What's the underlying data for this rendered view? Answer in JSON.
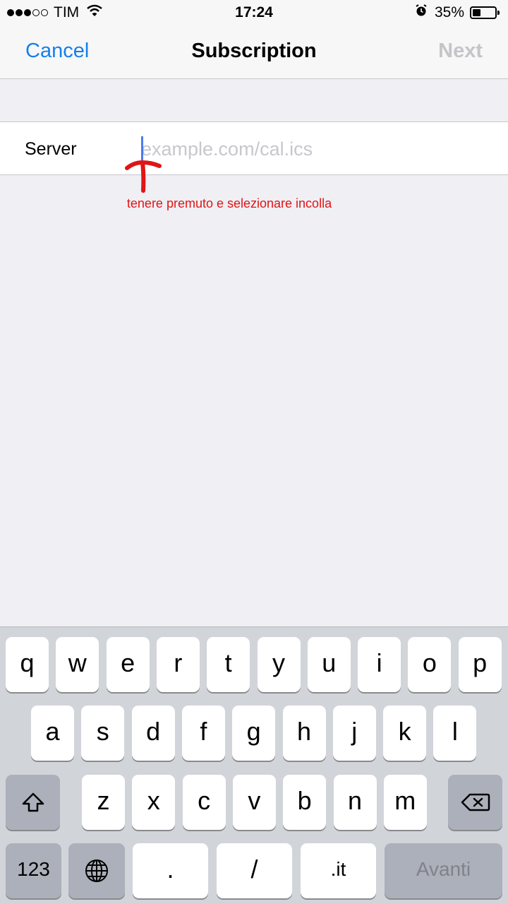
{
  "status_bar": {
    "signal_dots_filled": 3,
    "signal_dots_empty": 2,
    "carrier": "TIM",
    "time": "17:24",
    "battery_percent": "35%",
    "battery_level": 0.35,
    "icons": [
      "wifi-icon",
      "alarm-icon",
      "battery-icon"
    ]
  },
  "nav": {
    "cancel_label": "Cancel",
    "title": "Subscription",
    "next_label": "Next"
  },
  "form": {
    "server_label": "Server",
    "server_value": "",
    "server_placeholder": "example.com/cal.ics"
  },
  "annotation": {
    "note": "tenere premuto e selezionare incolla"
  },
  "keyboard": {
    "row1": [
      "q",
      "w",
      "e",
      "r",
      "t",
      "y",
      "u",
      "i",
      "o",
      "p"
    ],
    "row2": [
      "a",
      "s",
      "d",
      "f",
      "g",
      "h",
      "j",
      "k",
      "l"
    ],
    "row3": [
      "z",
      "x",
      "c",
      "v",
      "b",
      "n",
      "m"
    ],
    "numbers_label": "123",
    "dot_label": ".",
    "slash_label": "/",
    "it_label": ".it",
    "return_label": "Avanti"
  },
  "colors": {
    "accent": "#1480ec",
    "disabled": "#c4c4c9",
    "annotation": "#e01515",
    "background": "#efeff4",
    "keyboard_bg": "#d1d4d9"
  }
}
